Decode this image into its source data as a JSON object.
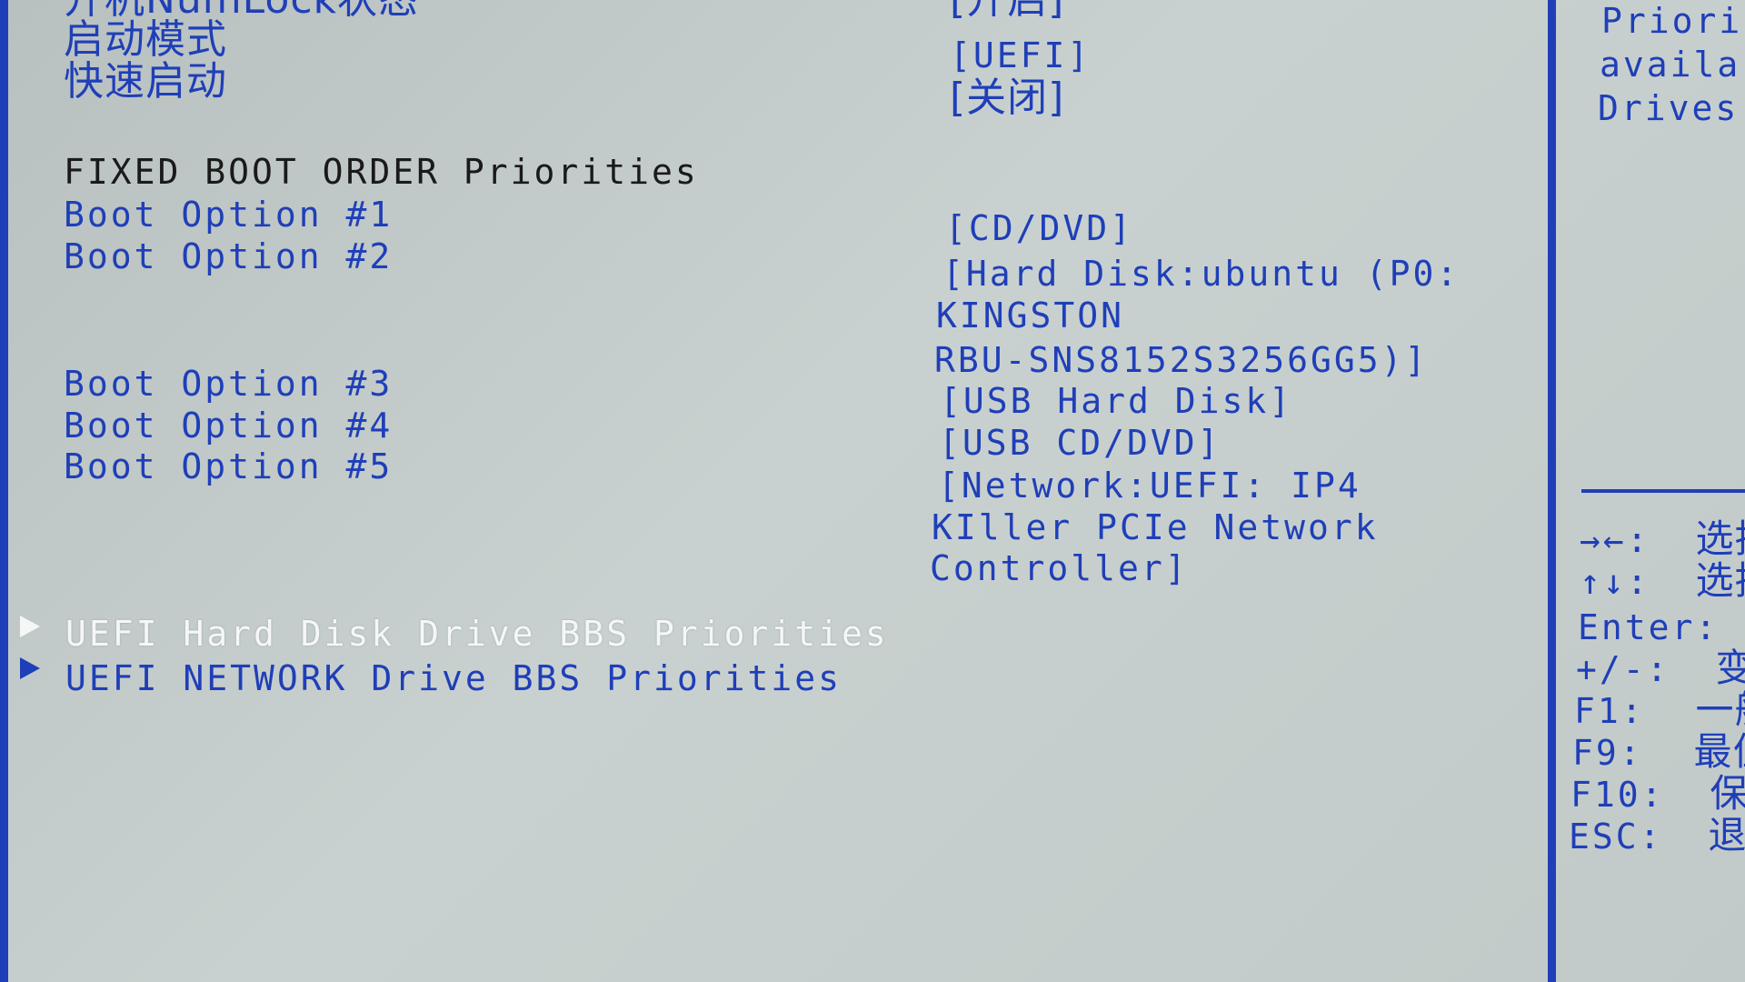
{
  "settings": {
    "numlock": {
      "label": "开机NumLock状态",
      "value": "[开启]"
    },
    "boot_mode": {
      "label": "启动模式",
      "value": "[UEFI]"
    },
    "fast_boot": {
      "label": "快速启动",
      "value": "[关闭]"
    }
  },
  "fixed_boot_order": {
    "header": "FIXED BOOT ORDER Priorities",
    "options": [
      {
        "label": "Boot Option #1",
        "value_lines": [
          "[CD/DVD]"
        ]
      },
      {
        "label": "Boot Option #2",
        "value_lines": [
          "[Hard Disk:ubuntu (P0:",
          "KINGSTON",
          "RBU-SNS8152S3256GG5)]"
        ]
      },
      {
        "label": "Boot Option #3",
        "value_lines": [
          "[USB Hard Disk]"
        ]
      },
      {
        "label": "Boot Option #4",
        "value_lines": [
          "[USB CD/DVD]"
        ]
      },
      {
        "label": "Boot Option #5",
        "value_lines": [
          "[Network:UEFI: IP4",
          "KIller PCIe Network",
          "Controller]"
        ]
      }
    ]
  },
  "submenus": [
    {
      "label": "UEFI Hard Disk Drive BBS Priorities",
      "selected": true
    },
    {
      "label": "UEFI NETWORK Drive BBS Priorities",
      "selected": false
    }
  ],
  "help_panel": {
    "description_lines": [
      "Priori",
      "availa",
      "Drives"
    ],
    "keys": [
      {
        "key": "→←:",
        "desc": "选择"
      },
      {
        "key": "↑↓:",
        "desc": "选择"
      },
      {
        "key": "Enter:",
        "desc": ""
      },
      {
        "key": "+/-:",
        "desc": "变"
      },
      {
        "key": "F1:",
        "desc": "一般"
      },
      {
        "key": "F9:",
        "desc": "最佳"
      },
      {
        "key": "F10:",
        "desc": "保存"
      },
      {
        "key": "ESC:",
        "desc": "退出"
      }
    ]
  },
  "colors": {
    "background": "#c3cbcb",
    "accent_blue": "#1f3fb8",
    "header_text": "#1a1a1a",
    "selected_text": "#f5f7f7"
  }
}
